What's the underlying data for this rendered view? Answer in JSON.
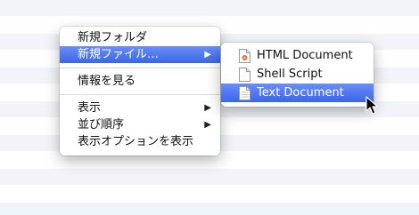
{
  "context_menu": {
    "items": [
      {
        "label": "新規フォルダ"
      },
      {
        "label": "新規ファイル…",
        "has_submenu": true,
        "highlighted": true
      },
      {
        "label": "情報を見る"
      },
      {
        "label": "表示",
        "has_submenu": true
      },
      {
        "label": "並び順序",
        "has_submenu": true
      },
      {
        "label": "表示オプションを表示"
      }
    ],
    "submenu_arrow": "▶"
  },
  "submenu": {
    "items": [
      {
        "label": "HTML Document",
        "icon": "html-document-icon"
      },
      {
        "label": "Shell Script",
        "icon": "script-document-icon"
      },
      {
        "label": "Text Document",
        "icon": "text-document-icon",
        "highlighted": true
      }
    ]
  },
  "colors": {
    "highlight": "#3a66e8",
    "stripe": "#f1f4f9"
  }
}
